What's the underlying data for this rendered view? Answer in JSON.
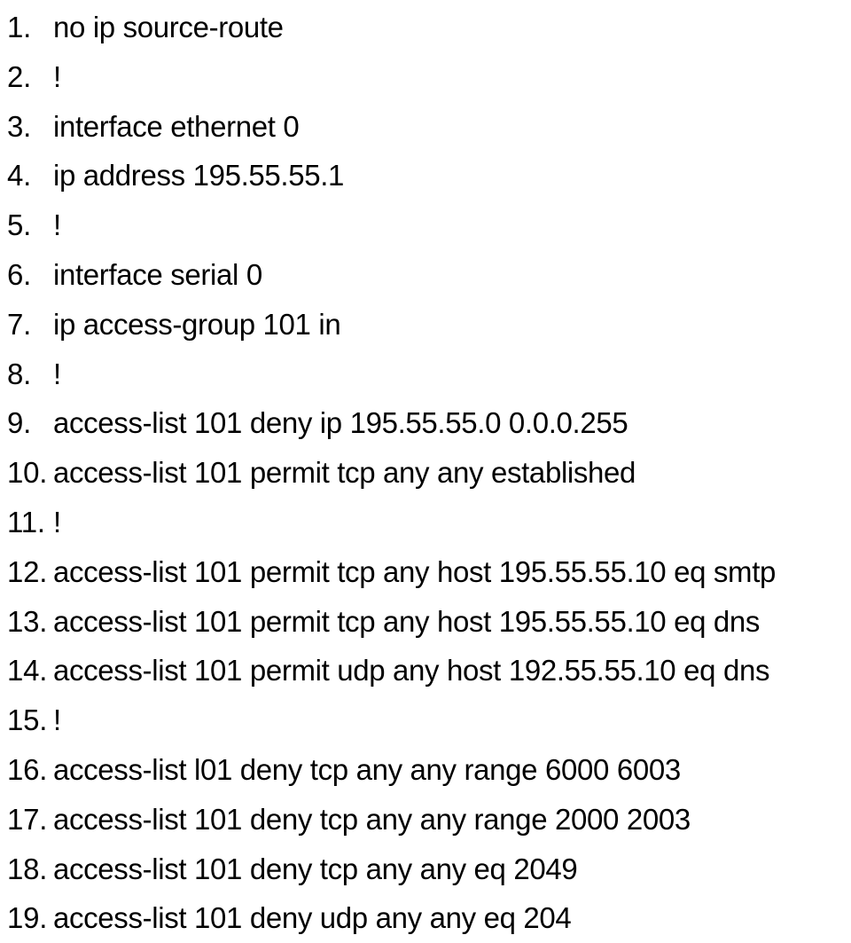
{
  "document": {
    "type": "numbered-configuration-listing",
    "background_color": "#ffffff",
    "text_color": "#000000",
    "total_lines": 19
  },
  "lines": [
    {
      "number": "1.",
      "text": "no ip source-route"
    },
    {
      "number": "2.",
      "text": "!"
    },
    {
      "number": "3.",
      "text": "interface ethernet 0"
    },
    {
      "number": "4.",
      "text": "ip address 195.55.55.1"
    },
    {
      "number": "5.",
      "text": "!"
    },
    {
      "number": "6.",
      "text": "interface serial 0"
    },
    {
      "number": "7.",
      "text": "ip access-group 101 in"
    },
    {
      "number": "8.",
      "text": "!"
    },
    {
      "number": "9.",
      "text": "access-list 101 deny ip 195.55.55.0 0.0.0.255"
    },
    {
      "number": "10.",
      "text": "access-list 101 permit tcp any any established"
    },
    {
      "number": "11.",
      "text": "!"
    },
    {
      "number": "12.",
      "text": "access-list 101 permit tcp any host 195.55.55.10 eq smtp"
    },
    {
      "number": "13.",
      "text": "access-list 101 permit tcp any host 195.55.55.10 eq dns"
    },
    {
      "number": "14.",
      "text": "access-list 101 permit udp any host 192.55.55.10 eq dns"
    },
    {
      "number": "15.",
      "text": "!"
    },
    {
      "number": "16.",
      "text": "access-list l01 deny tcp any any range 6000 6003"
    },
    {
      "number": "17.",
      "text": "access-list 101 deny tcp any any range 2000 2003"
    },
    {
      "number": "18.",
      "text": "access-list 101 deny tcp any any eq 2049"
    },
    {
      "number": "19.",
      "text": "access-list 101 deny udp any any eq 204"
    }
  ]
}
